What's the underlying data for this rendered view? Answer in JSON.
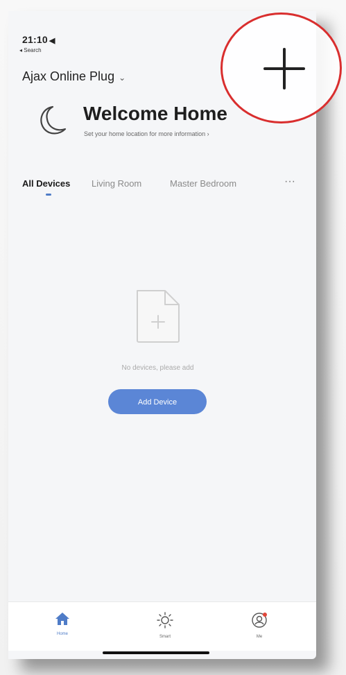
{
  "status_bar": {
    "time": "21:10",
    "location_glyph": "◀",
    "back_label": "◂ Search"
  },
  "header": {
    "home_name": "Ajax Online Plug",
    "home_chevron": "⌄",
    "welcome_title": "Welcome Home",
    "welcome_subtitle": "Set your home location for more information ›"
  },
  "tabs": [
    {
      "label": "All Devices",
      "active": true
    },
    {
      "label": "Living Room",
      "active": false
    },
    {
      "label": "Master Bedroom",
      "active": false
    }
  ],
  "more_label": "···",
  "empty_state": {
    "message": "No devices, please add",
    "button_label": "Add Device"
  },
  "bottom_nav": [
    {
      "label": "Home",
      "icon": "house-icon"
    },
    {
      "label": "Smart",
      "icon": "sun-icon"
    },
    {
      "label": "Me",
      "icon": "profile-icon"
    }
  ],
  "colors": {
    "accent": "#5b86d6",
    "highlight_circle": "#d92e2e"
  }
}
